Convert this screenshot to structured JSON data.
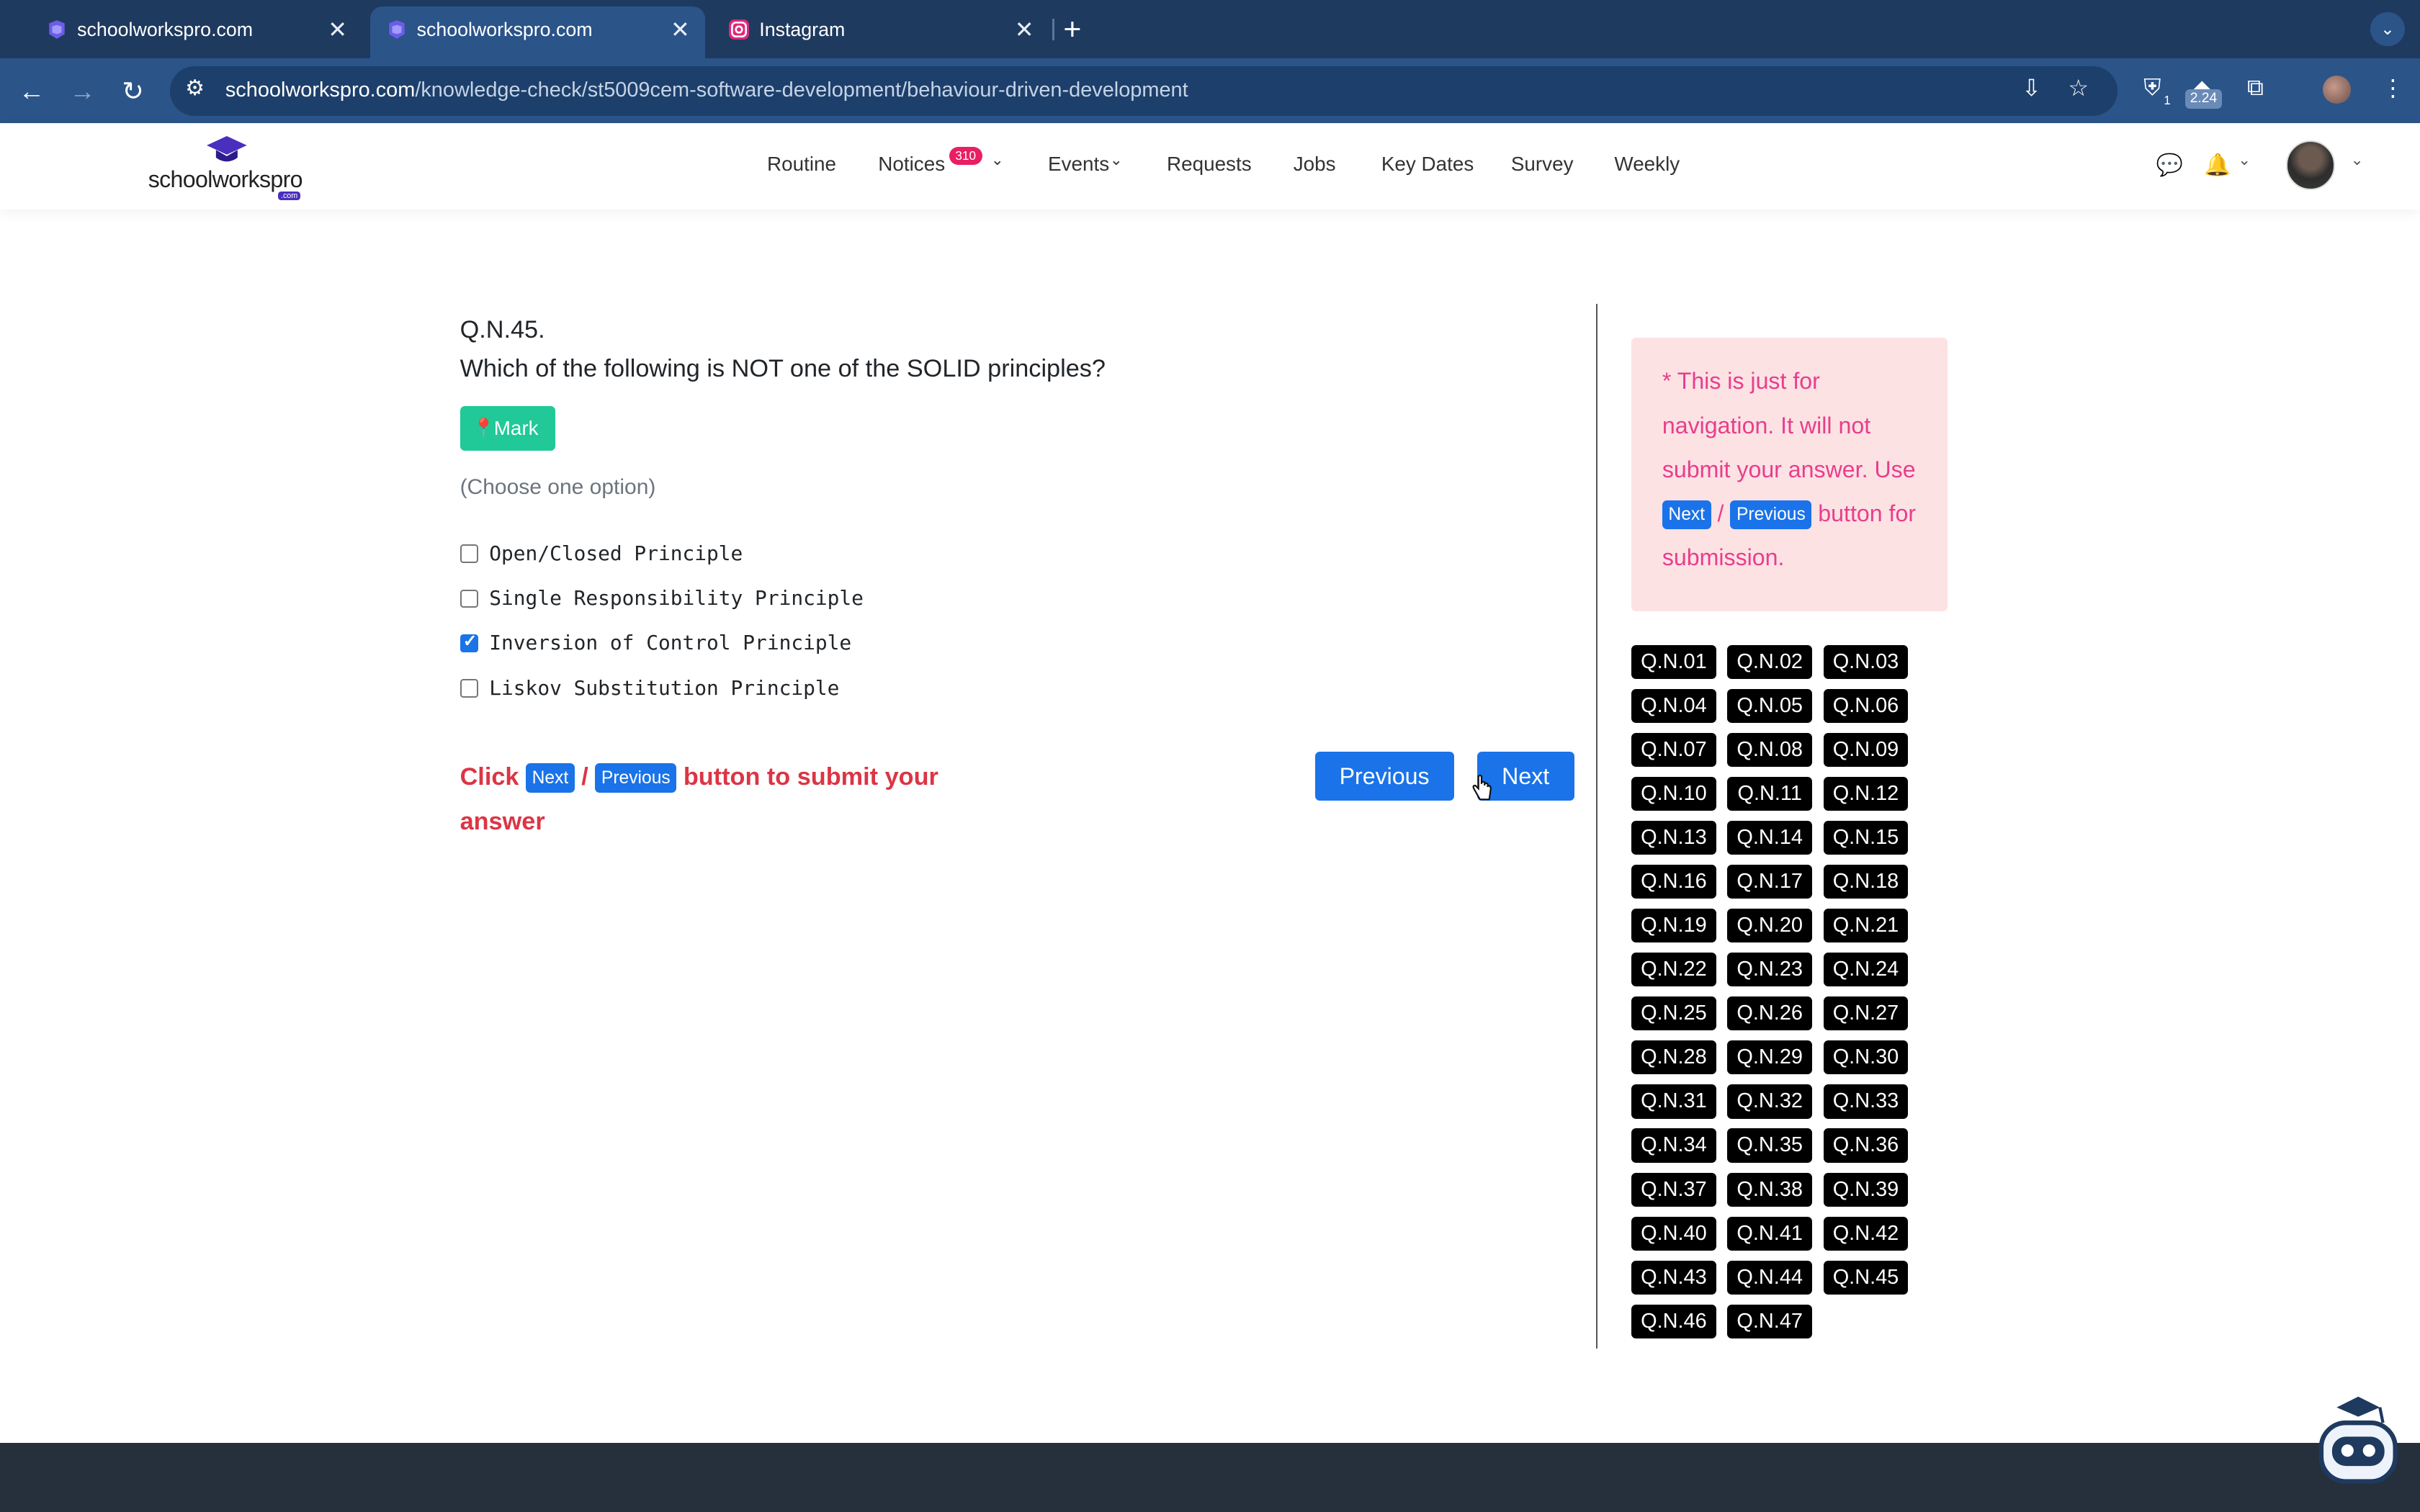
{
  "browser": {
    "tabs": [
      {
        "title": "schoolworkspro.com",
        "active": false
      },
      {
        "title": "schoolworkspro.com",
        "active": true
      },
      {
        "title": "Instagram",
        "active": false
      }
    ],
    "url_host": "schoolworkspro.com",
    "url_path": "/knowledge-check/st5009cem-software-development/behaviour-driven-development",
    "extension_badge_count": "1",
    "extension_version_badge": "2.24"
  },
  "header": {
    "logo_text": "schoolworkspro",
    "logo_sub": ".com",
    "nav": [
      {
        "label": "Routine"
      },
      {
        "label": "Notices",
        "badge": "310",
        "dropdown": true
      },
      {
        "label": "Events",
        "dropdown": true
      },
      {
        "label": "Requests"
      },
      {
        "label": "Jobs"
      },
      {
        "label": "Key Dates"
      },
      {
        "label": "Survey"
      },
      {
        "label": "Weekly"
      }
    ]
  },
  "question": {
    "number": "Q.N.45.",
    "text": "Which of the following is NOT one of the SOLID principles?",
    "mark_label": "Mark",
    "instruction": "(Choose one option)",
    "options": [
      {
        "label": "Open/Closed Principle",
        "checked": false
      },
      {
        "label": "Single Responsibility Principle",
        "checked": false
      },
      {
        "label": "Inversion of Control Principle",
        "checked": true
      },
      {
        "label": "Liskov Substitution Principle",
        "checked": false
      }
    ]
  },
  "submit_note": {
    "prefix": "Click",
    "next": "Next",
    "slash": "/",
    "previous": "Previous",
    "suffix": "button to submit your answer"
  },
  "buttons": {
    "previous": "Previous",
    "next": "Next"
  },
  "nav_info": {
    "line1": "* This is just for navigation. It will not submit your answer. Use",
    "next": "Next",
    "slash": "/",
    "previous": "Previous",
    "line2": "button for submission."
  },
  "question_nav": [
    "Q.N.01",
    "Q.N.02",
    "Q.N.03",
    "Q.N.04",
    "Q.N.05",
    "Q.N.06",
    "Q.N.07",
    "Q.N.08",
    "Q.N.09",
    "Q.N.10",
    "Q.N.11",
    "Q.N.12",
    "Q.N.13",
    "Q.N.14",
    "Q.N.15",
    "Q.N.16",
    "Q.N.17",
    "Q.N.18",
    "Q.N.19",
    "Q.N.20",
    "Q.N.21",
    "Q.N.22",
    "Q.N.23",
    "Q.N.24",
    "Q.N.25",
    "Q.N.26",
    "Q.N.27",
    "Q.N.28",
    "Q.N.29",
    "Q.N.30",
    "Q.N.31",
    "Q.N.32",
    "Q.N.33",
    "Q.N.34",
    "Q.N.35",
    "Q.N.36",
    "Q.N.37",
    "Q.N.38",
    "Q.N.39",
    "Q.N.40",
    "Q.N.41",
    "Q.N.42",
    "Q.N.43",
    "Q.N.44",
    "Q.N.45",
    "Q.N.46",
    "Q.N.47"
  ],
  "colors": {
    "accent": "#1a73e8",
    "mark": "#20c997",
    "warning_text": "#dc3545",
    "info_bg": "#fde2e4",
    "info_text": "#e83e8c"
  }
}
